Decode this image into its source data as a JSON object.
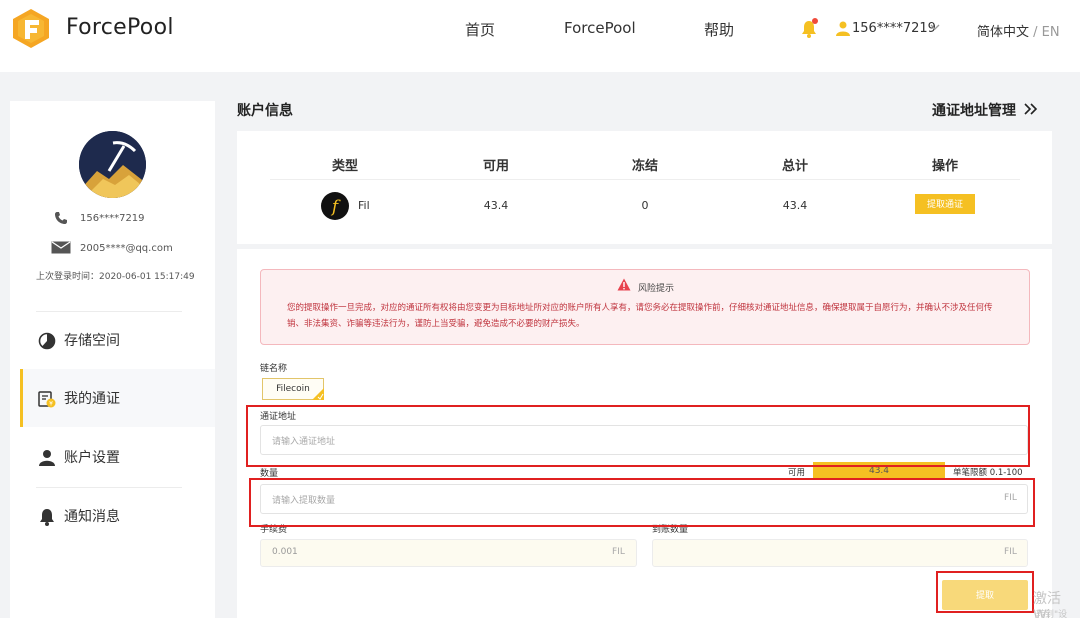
{
  "header": {
    "brand": "ForcePool",
    "nav": [
      "首页",
      "ForcePool",
      "帮助"
    ],
    "user": "156****7219",
    "lang_active": "简体中文",
    "lang_sep": " / ",
    "lang_other": "EN"
  },
  "profile": {
    "phone": "156****7219",
    "email": "2005****@qq.com",
    "last_login": "上次登录时间：2020-06-01 15:17:49"
  },
  "menu": [
    {
      "label": "存储空间",
      "icon": "pie-chart-icon",
      "active": false
    },
    {
      "label": "我的通证",
      "icon": "token-icon",
      "active": true
    },
    {
      "label": "账户设置",
      "icon": "user-icon",
      "active": false
    },
    {
      "label": "通知消息",
      "icon": "bell-icon",
      "active": false
    }
  ],
  "main": {
    "section_title": "账户信息",
    "addr_mgmt": "通证地址管理"
  },
  "table": {
    "headers": [
      "类型",
      "可用",
      "冻结",
      "总计",
      "操作"
    ],
    "row": {
      "name": "Fil",
      "available": "43.4",
      "frozen": "0",
      "total": "43.4",
      "action": "提取通证"
    }
  },
  "risk": {
    "title": "风险提示",
    "text": "您的提取操作一旦完成，对应的通证所有权将由您变更为目标地址所对应的账户所有人享有，请您务必在提取操作前，仔细核对通证地址信息，确保提取属于自愿行为，并确认不涉及任何传销、非法集资、诈骗等违法行为，谨防上当受骗，避免造成不必要的财产损失。"
  },
  "form": {
    "chain_label": "链名称",
    "chain_value": "Filecoin",
    "address_label": "通证地址",
    "address_placeholder": "请输入通证地址",
    "amount_label": "数量",
    "available_label": "可用",
    "available_value": "43.4",
    "limit_label": "单笔限额",
    "limit_value": "0.1-100",
    "amount_placeholder": "请输入提取数量",
    "unit": "FIL",
    "fee_label": "手续费",
    "fee_value": "0.001",
    "receive_label": "到账数量",
    "submit": "提取"
  },
  "watermark": {
    "line1": "激活 Wi",
    "line2": "转到\"设置\""
  },
  "colors": {
    "accent": "#f5c022",
    "danger": "#e02020",
    "risk_bg": "#fdf0f1"
  }
}
